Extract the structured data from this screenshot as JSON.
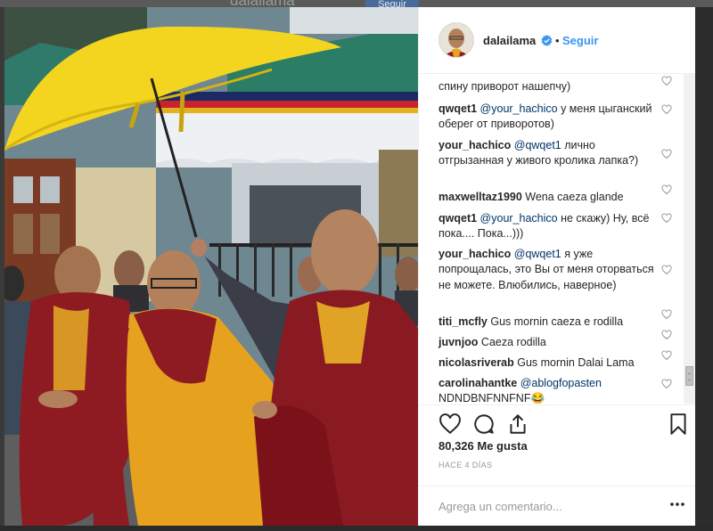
{
  "background_page": {
    "username": "dalailama",
    "follow_label": "Seguir"
  },
  "post": {
    "username": "dalailama",
    "verified": true,
    "separator": "•",
    "follow_label": "Seguir"
  },
  "comments": [
    {
      "user": "",
      "mention": "",
      "text": "спину приворот нашепчу)"
    },
    {
      "user": "qwqet1",
      "mention": "@your_hachico",
      "text": " у меня цыганский оберег от приворотов)"
    },
    {
      "user": "your_hachico",
      "mention": "@qwqet1",
      "text": " лично отгрызанная у живого кролика лапка?)"
    },
    {
      "user": "maxwelltaz1990",
      "mention": "",
      "text": " Wena caeza glande"
    },
    {
      "user": "qwqet1",
      "mention": "@your_hachico",
      "text": " не скажу) Ну, всё пока.... Пока...)))"
    },
    {
      "user": "your_hachico",
      "mention": "@qwqet1",
      "text": " я уже попрощалась, это Вы от меня оторваться не можете. Влюбились, наверное)"
    },
    {
      "user": "titi_mcfly",
      "mention": "",
      "text": " Gus mornin caeza e rodilla"
    },
    {
      "user": "juvnjoo",
      "mention": "",
      "text": " Caeza rodilla"
    },
    {
      "user": "nicolasriverab",
      "mention": "",
      "text": " Gus mornin Dalai Lama"
    },
    {
      "user": "carolinahantke",
      "mention": "@ablogfopasten",
      "text": " NDNDBNFNNFNF😂"
    }
  ],
  "likes": "80,326 Me gusta",
  "time_ago": "HACE 4 DÍAS",
  "comment_input": {
    "placeholder": "Agrega un comentario..."
  },
  "icons": {
    "like": "heart-icon",
    "comment": "comment-bubble-icon",
    "share": "share-icon",
    "save": "bookmark-icon",
    "more": "more-dots-icon",
    "verified": "verified-badge-icon"
  },
  "colors": {
    "link": "#3897f0",
    "mention": "#003569",
    "text": "#262626",
    "muted": "#999999",
    "umbrella": "#f2d21e",
    "robe_maroon": "#8e1b22",
    "robe_saffron": "#e6a21e"
  }
}
